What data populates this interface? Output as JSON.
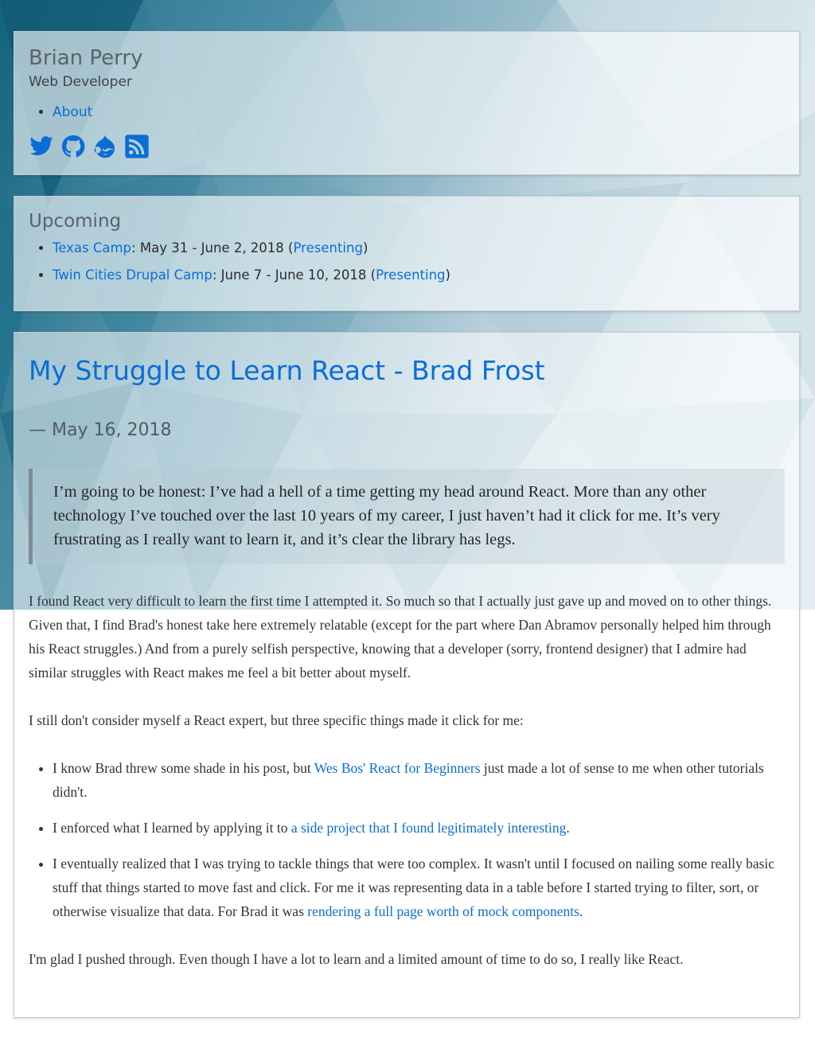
{
  "site": {
    "name": "Brian Perry",
    "slogan": "Web Developer",
    "menu": [
      {
        "label": "About"
      }
    ],
    "social_icons": [
      "twitter-icon",
      "github-icon",
      "drupal-icon",
      "rss-icon"
    ]
  },
  "upcoming": {
    "title": "Upcoming",
    "events": [
      {
        "name": "Texas Camp",
        "dates": ": May 31 - June 2, 2018 (",
        "status": "Presenting",
        "close": ")"
      },
      {
        "name": "Twin Cities Drupal Camp",
        "dates": ": June 7 - June 10, 2018 (",
        "status": "Presenting",
        "close": ")"
      }
    ]
  },
  "post": {
    "title": "My Struggle to Learn React - Brad Frost",
    "date": "— May 16, 2018",
    "quote": "I’m going to be honest: I’ve had a hell of a time getting my head around React. More than any other technology I’ve touched over the last 10 years of my career, I just haven’t had it click for me. It’s very frustrating as I really want to learn it, and it’s clear the library has legs.",
    "paragraph1": "I found React very difficult to learn the first time I attempted it. So much so that I actually just gave up and moved on to other things. Given that, I find Brad's honest take here extremely relatable (except for the part where Dan Abramov personally helped him through his React struggles.) And from a purely selfish perspective, knowing that a developer (sorry, frontend designer) that I admire had similar struggles with React makes me feel a bit better about myself.",
    "paragraph2": "I still don't consider myself a React expert, but three specific things made it click for me:",
    "list": [
      {
        "before": "I know Brad threw some shade in his post, but ",
        "link": "Wes Bos' React for Beginners",
        "after": " just made a lot of sense to me when other tutorials didn't."
      },
      {
        "before": "I enforced what I learned by applying it to ",
        "link": "a side project that I found legitimately interesting",
        "after": "."
      },
      {
        "before": "I eventually realized that I was trying to tackle things that were too complex. It wasn't until I focused on nailing some really basic stuff that things started to move fast and click. For me it was representing data in a table before I started trying to filter, sort, or otherwise visualize that data. For Brad it was ",
        "link": "rendering a full page worth of mock components",
        "after": "."
      }
    ],
    "paragraph3": "I'm glad I pushed through. Even though I have a lot to learn and a limited amount of time to do so, I really like React."
  },
  "colors": {
    "link": "#0a6dd6",
    "bg_dark": "#1a6a86",
    "bg_light": "#dbe8ee"
  }
}
